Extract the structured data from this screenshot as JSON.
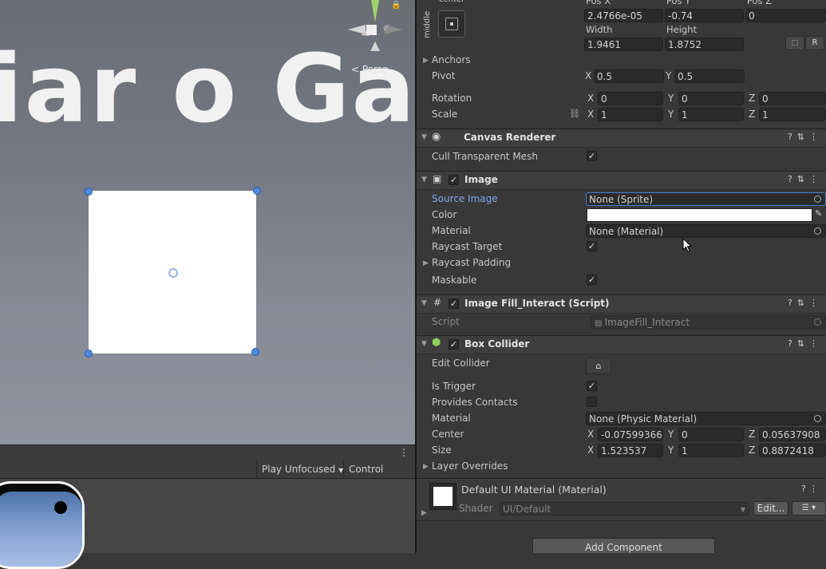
{
  "scene": {
    "big_text": "iar o Gar",
    "persp_label": "< Persp"
  },
  "game_toolbar": {
    "play_mode": "Play Unfocused",
    "control_panel": "Control Panel"
  },
  "rect_transform": {
    "anchor_preset_top": "center",
    "anchor_preset_side": "middle",
    "headers": [
      "Pos X",
      "Pos Y",
      "Pos Z"
    ],
    "pos_x": "2.4766e-05",
    "pos_y": "-0.74",
    "pos_z": "0",
    "width_label": "Width",
    "height_label": "Height",
    "width": "1.9461",
    "height": "1.8752",
    "r_button": "R",
    "anchors_label": "Anchors",
    "pivot_label": "Pivot",
    "pivot_x": "0.5",
    "pivot_y": "0.5",
    "rotation_label": "Rotation",
    "rot_x": "0",
    "rot_y": "0",
    "rot_z": "0",
    "scale_label": "Scale",
    "scale_x": "1",
    "scale_y": "1",
    "scale_z": "1",
    "axis_x": "X",
    "axis_y": "Y",
    "axis_z": "Z"
  },
  "canvas_renderer": {
    "title": "Canvas Renderer",
    "cull_label": "Cull Transparent Mesh",
    "cull_checked": true
  },
  "image": {
    "title": "Image",
    "source_image_label": "Source Image",
    "source_image_value": "None (Sprite)",
    "color_label": "Color",
    "color_value": "#ffffff",
    "material_label": "Material",
    "material_value": "None (Material)",
    "raycast_target_label": "Raycast Target",
    "raycast_padding_label": "Raycast Padding",
    "maskable_label": "Maskable"
  },
  "script_comp": {
    "title": "Image Fill_Interact (Script)",
    "script_label": "Script",
    "script_value": "ImageFill_Interact"
  },
  "box_collider": {
    "title": "Box Collider",
    "edit_collider_label": "Edit Collider",
    "is_trigger_label": "Is Trigger",
    "provides_contacts_label": "Provides Contacts",
    "material_label": "Material",
    "material_value": "None (Physic Material)",
    "center_label": "Center",
    "center_x": "-0.07599366",
    "center_y": "0",
    "center_z": "0.05637908",
    "size_label": "Size",
    "size_x": "1.523537",
    "size_y": "1",
    "size_z": "0.8872418",
    "layer_overrides_label": "Layer Overrides"
  },
  "material_preview": {
    "title": "Default UI Material (Material)",
    "shader_label": "Shader",
    "shader_value": "UI/Default",
    "edit_button": "Edit..."
  },
  "add_component": "Add Component",
  "colors": {
    "accent_blue": "#7ea7e8",
    "handle_blue": "#4d8be0",
    "inspector_bg": "#383838"
  }
}
